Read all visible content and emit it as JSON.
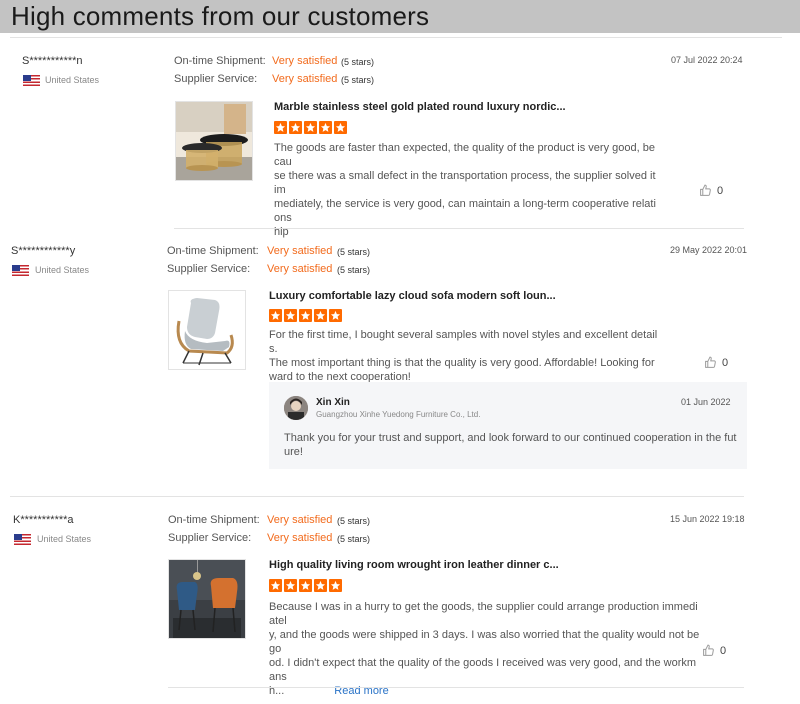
{
  "header": {
    "title": "High comments from our customers"
  },
  "labels": {
    "shipment": "On-time Shipment:",
    "service": "Supplier Service:"
  },
  "colors": {
    "accent": "#f26b1d",
    "star": "#ff6a00",
    "header_bg": "#c3c3c3",
    "link": "#2a73c7"
  },
  "reviews": [
    {
      "name": "S***********n",
      "country": "United States",
      "shipment_value": "Very satisfied",
      "shipment_stars": "(5 stars)",
      "service_value": "Very satisfied",
      "service_stars": "(5 stars)",
      "date": "07 Jul 2022 20:24",
      "product_title": "Marble stainless steel gold plated round luxury nordic...",
      "rating": 5,
      "review_lines": [
        "The goods are faster than expected, the quality of the product is very good, becau",
        "se there was a small defect in the transportation process, the supplier solved it im",
        "mediately, the service is very good, can maintain a long-term cooperative relations",
        "hip"
      ],
      "likes": "0"
    },
    {
      "name": "S************y",
      "country": "United States",
      "shipment_value": "Very satisfied",
      "shipment_stars": "(5 stars)",
      "service_value": "Very satisfied",
      "service_stars": "(5 stars)",
      "date": "29 May 2022 20:01",
      "product_title": "Luxury comfortable lazy cloud sofa modern soft loun...",
      "rating": 5,
      "review_lines": [
        "For the first time, I bought several samples with novel styles and excellent details.",
        "The most important thing is that the quality is very good. Affordable! Looking for",
        "ward to the next cooperation!"
      ],
      "likes": "0",
      "reply": {
        "name": "Xin Xin",
        "company": "Guangzhou Xinhe Yuedong Furniture Co., Ltd.",
        "date": "01 Jun 2022",
        "lines": [
          "Thank you for your trust and support, and look forward to our continued cooperation in the fut",
          "ure!"
        ]
      }
    },
    {
      "name": "K***********a",
      "country": "United States",
      "shipment_value": "Very satisfied",
      "shipment_stars": "(5 stars)",
      "service_value": "Very satisfied",
      "service_stars": "(5 stars)",
      "date": "15 Jun 2022 19:18",
      "product_title": "High quality living room wrought iron leather dinner c...",
      "rating": 5,
      "review_lines": [
        "Because I was in a hurry to get the goods, the supplier could arrange production immediatel",
        "y, and the goods were shipped in 3 days. I was also worried that the quality would not be go",
        "od. I didn't expect that the quality of the goods I received was very good, and the workmans",
        "h..."
      ],
      "read_more": "Read more",
      "likes": "0"
    }
  ]
}
